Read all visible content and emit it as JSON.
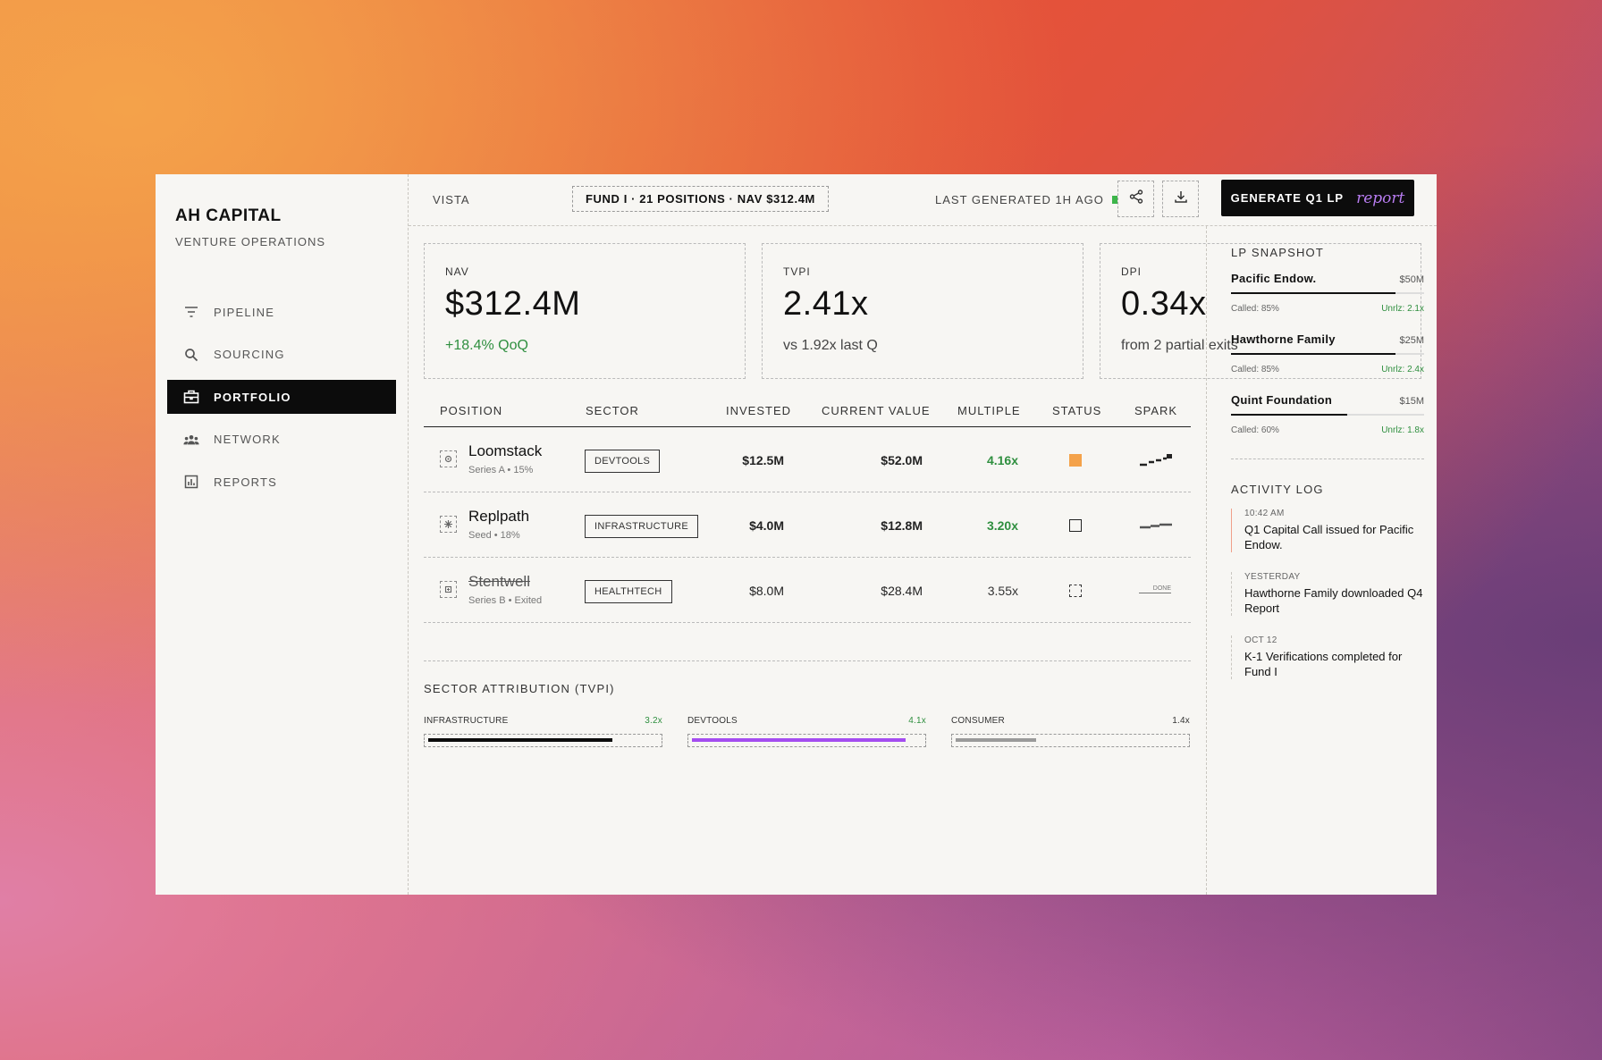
{
  "sidebar": {
    "brand": "AH CAPITAL",
    "subtitle": "VENTURE OPERATIONS",
    "items": [
      {
        "label": "PIPELINE",
        "icon": "filter-icon"
      },
      {
        "label": "SOURCING",
        "icon": "search-icon"
      },
      {
        "label": "PORTFOLIO",
        "icon": "briefcase-icon",
        "active": true
      },
      {
        "label": "NETWORK",
        "icon": "people-icon"
      },
      {
        "label": "REPORTS",
        "icon": "bar-chart-icon"
      }
    ]
  },
  "header": {
    "breadcrumb": "VISTA",
    "fund_chip": "FUND I · 21 POSITIONS · NAV $312.4M",
    "last_generated": "LAST GENERATED 1H AGO",
    "status_color": "#3db54a",
    "generate_label": "GENERATE Q1 LP",
    "generate_suffix": "report",
    "share_icon": "share-icon",
    "download_icon": "download-icon"
  },
  "kpis": [
    {
      "label": "NAV",
      "value": "$312.4M",
      "sub": "+18.4% QoQ"
    },
    {
      "label": "TVPI",
      "value": "2.41x",
      "sub": "vs 1.92x last Q"
    },
    {
      "label": "DPI",
      "value": "0.34x",
      "sub": "from 2 partial exits"
    }
  ],
  "table": {
    "columns": [
      "POSITION",
      "SECTOR",
      "INVESTED",
      "CURRENT VALUE",
      "MULTIPLE",
      "STATUS",
      "SPARK"
    ],
    "rows": [
      {
        "name": "Loomstack",
        "meta": "Series A • 15%",
        "sector": "DEVTOOLS",
        "invested": "$12.5M",
        "current": "$52.0M",
        "multiple": "4.16x",
        "status": "filled",
        "spark": ""
      },
      {
        "name": "Replpath",
        "meta": "Seed • 18%",
        "sector": "INFRASTRUCTURE",
        "invested": "$4.0M",
        "current": "$12.8M",
        "multiple": "3.20x",
        "status": "open",
        "spark": ""
      },
      {
        "name": "Stentwell",
        "meta": "Series B • Exited",
        "sector": "HEALTHTECH",
        "invested": "$8.0M",
        "current": "$28.4M",
        "multiple": "3.55x",
        "status": "dashed",
        "spark": "DONE"
      }
    ]
  },
  "sector_attribution": {
    "title": "SECTOR ATTRIBUTION (TVPI)",
    "items": [
      {
        "label": "INFRASTRUCTURE",
        "value": "3.2x",
        "fill": 0.8,
        "color": "#0c0c0c"
      },
      {
        "label": "DEVTOOLS",
        "value": "4.1x",
        "fill": 0.93,
        "color": "#a44df0"
      },
      {
        "label": "CONSUMER",
        "value": "1.4x",
        "fill": 0.35,
        "color": "#9a9a9a"
      }
    ]
  },
  "lp_snapshot": {
    "title": "LP SNAPSHOT",
    "items": [
      {
        "name": "Pacific Endow.",
        "amount": "$50M",
        "called": "Called: 85%",
        "unrlz": "Unrlz: 2.1x",
        "fill": 0.85
      },
      {
        "name": "Hawthorne Family",
        "amount": "$25M",
        "called": "Called: 85%",
        "unrlz": "Unrlz: 2.4x",
        "fill": 0.85
      },
      {
        "name": "Quint Foundation",
        "amount": "$15M",
        "called": "Called: 60%",
        "unrlz": "Unrlz: 1.8x",
        "fill": 0.6
      }
    ]
  },
  "activity_log": {
    "title": "ACTIVITY LOG",
    "items": [
      {
        "time": "10:42 AM",
        "message": "Q1 Capital Call issued for Pacific Endow."
      },
      {
        "time": "YESTERDAY",
        "message": "Hawthorne Family downloaded Q4 Report"
      },
      {
        "time": "OCT 12",
        "message": "K-1 Verifications completed for Fund I"
      }
    ]
  }
}
